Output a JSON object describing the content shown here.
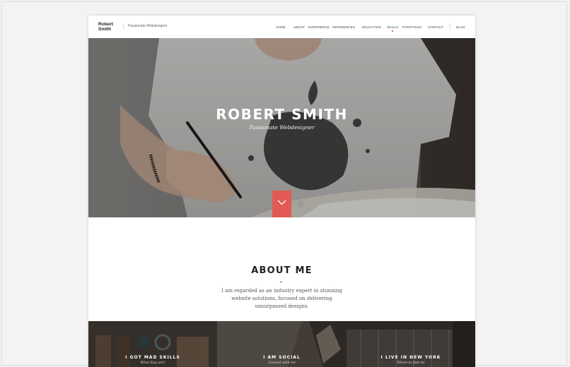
{
  "brand": {
    "name_line1": "Robert",
    "name_line2": "Smith",
    "tagline": "Passionate Webdesigner"
  },
  "nav": {
    "items": [
      "HOME",
      "ABOUT",
      "EXPERIENCE",
      "REFERENCES",
      "EDUCATION",
      "SKILLS",
      "PORTFOLIO",
      "CONTACT"
    ],
    "blog": "BLOG",
    "active": "SKILLS"
  },
  "hero": {
    "title": "ROBERT SMITH",
    "subtitle": "Passionate Webdesigner",
    "scroll_icon": "chevron-down-icon"
  },
  "about": {
    "title": "ABOUT ME",
    "text": "I am regarded as an industry expert in stunning website solutions, focused on delivering unsurpassed designs."
  },
  "tiles": [
    {
      "title": "I GOT MAD SKILLS",
      "subtitle": "What they are?"
    },
    {
      "title": "I AM SOCIAL",
      "subtitle": "Connect with me"
    },
    {
      "title": "I LIVE IN NEW YORK",
      "subtitle": "Where to find me"
    }
  ],
  "colors": {
    "accent": "#e25a55",
    "hero_overlay": "#5a5a5a"
  }
}
